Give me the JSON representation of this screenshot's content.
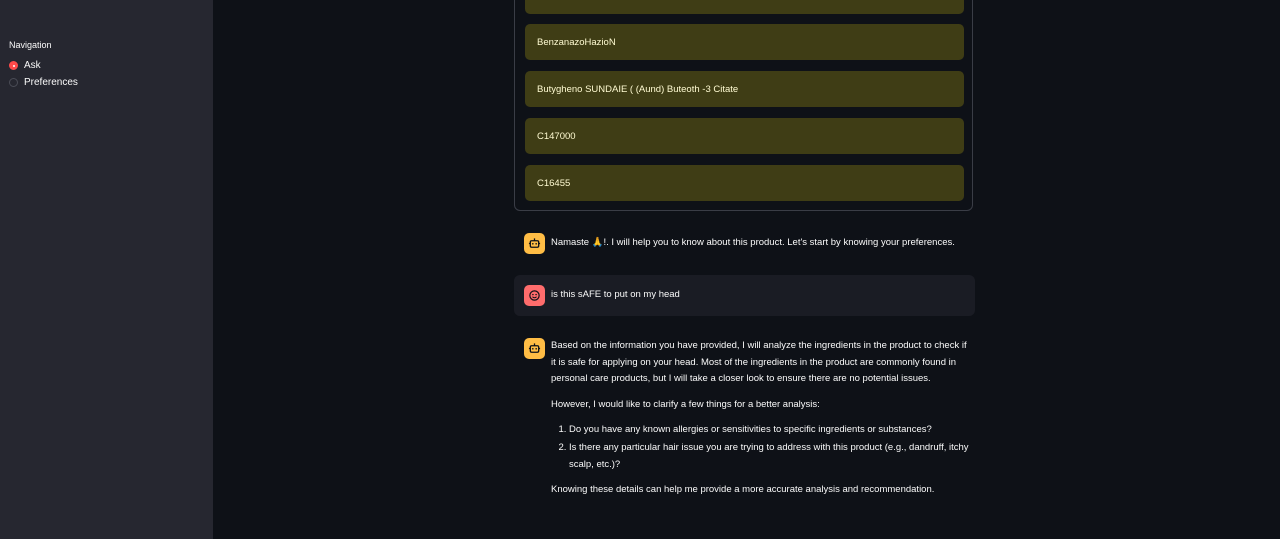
{
  "sidebar": {
    "title": "Navigation",
    "options": [
      {
        "label": "Ask",
        "selected": true
      },
      {
        "label": "Preferences",
        "selected": false
      }
    ]
  },
  "ingredients": [
    "BenzanazoHazioN",
    "Butygheno SUNDAIE ( (Aund) Buteoth -3 Citate",
    "C147000",
    "C16455"
  ],
  "chat": {
    "greeting": "Namaste 🙏!. I will help you to know about this product. Let's start by knowing your preferences.",
    "user_message": "is this sAFE to put on my head",
    "response": {
      "para1": "Based on the information you have provided, I will analyze the ingredients in the product to check if it is safe for applying on your head. Most of the ingredients in the product are commonly found in personal care products, but I will take a closer look to ensure there are no potential issues.",
      "para2": "However, I would like to clarify a few things for a better analysis:",
      "items": [
        "Do you have any known allergies or sensitivities to specific ingredients or substances?",
        "Is there any particular hair issue you are trying to address with this product (e.g., dandruff, itchy scalp, etc.)?"
      ],
      "para3": "Knowing these details can help me provide a more accurate analysis and recommendation."
    }
  },
  "colors": {
    "accent": "#ff4b4b",
    "bot_avatar": "#ffbd45",
    "user_avatar": "#ff6c6c",
    "ingredient_bg": "#3f3d15"
  }
}
